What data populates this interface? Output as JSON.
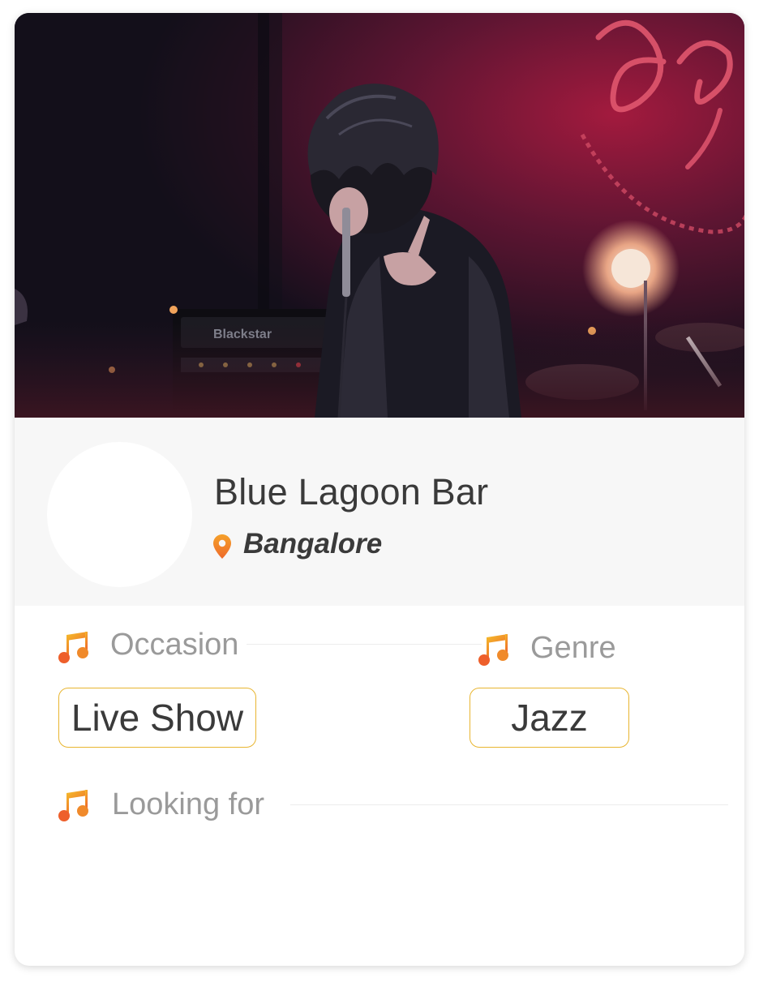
{
  "venue": {
    "name": "Blue Lagoon Bar",
    "city": "Bangalore"
  },
  "sections": {
    "occasion": {
      "label": "Occasion",
      "value": "Live Show"
    },
    "genre": {
      "label": "Genre",
      "value": "Jazz"
    },
    "looking_for": {
      "label": "Looking for"
    }
  },
  "icons": {
    "section": "music-note-icon",
    "location": "location-pin-icon"
  },
  "colors": {
    "accent_start": "#f5c02a",
    "accent_end": "#ee5f2b",
    "chip_border": "#e8b530",
    "text_primary": "#3a3a3a",
    "text_secondary": "#9a9a9a",
    "profile_band": "#f7f7f7"
  }
}
